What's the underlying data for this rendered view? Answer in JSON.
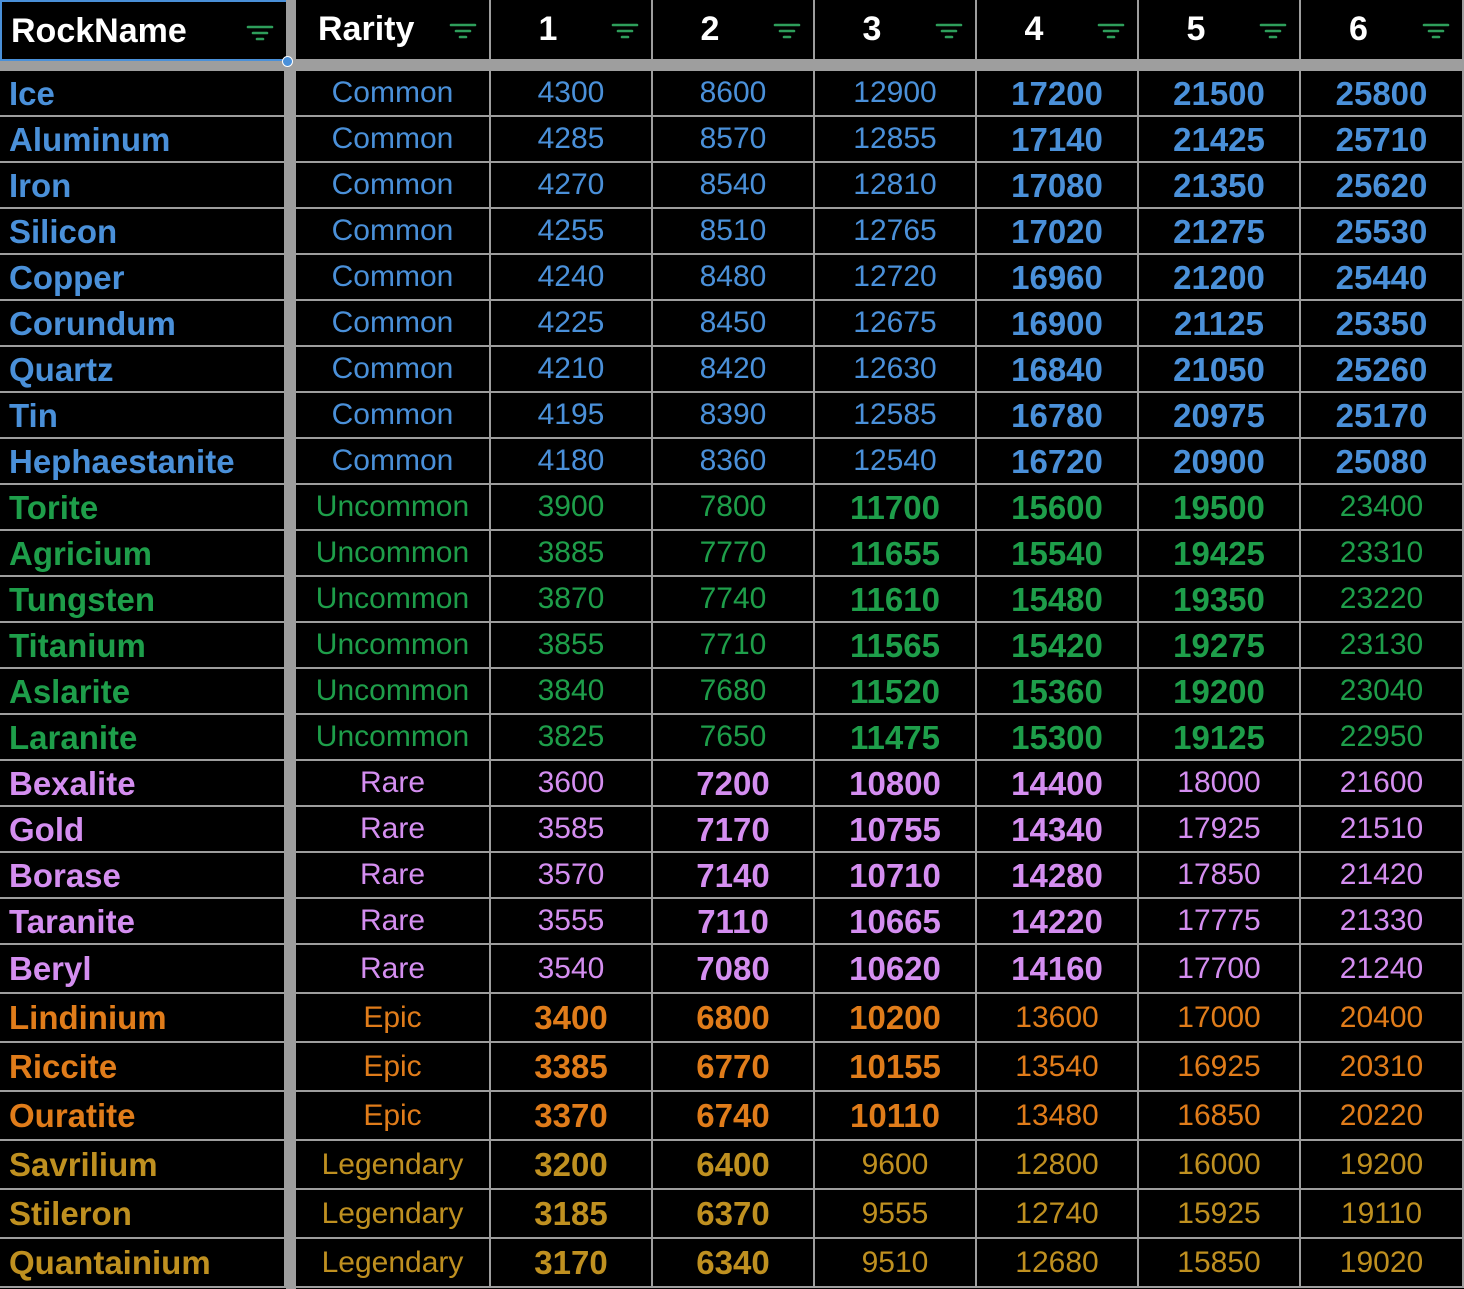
{
  "headers": [
    "RockName",
    "Rarity",
    "1",
    "2",
    "3",
    "4",
    "5",
    "6"
  ],
  "rarity_colors": {
    "Common": "#4a90d9",
    "Uncommon": "#1e9e4a",
    "Rare": "#d48ef0",
    "Epic": "#e07c1a",
    "Legendary": "#bf9020"
  },
  "filter_icon_color": "#2e9e5b",
  "rows": [
    {
      "name": "Ice",
      "rarity": "Common",
      "values": [
        "4300",
        "8600",
        "12900",
        "17200",
        "21500",
        "25800"
      ],
      "bold": [
        false,
        false,
        false,
        true,
        true,
        true
      ]
    },
    {
      "name": "Aluminum",
      "rarity": "Common",
      "values": [
        "4285",
        "8570",
        "12855",
        "17140",
        "21425",
        "25710"
      ],
      "bold": [
        false,
        false,
        false,
        true,
        true,
        true
      ]
    },
    {
      "name": "Iron",
      "rarity": "Common",
      "values": [
        "4270",
        "8540",
        "12810",
        "17080",
        "21350",
        "25620"
      ],
      "bold": [
        false,
        false,
        false,
        true,
        true,
        true
      ]
    },
    {
      "name": "Silicon",
      "rarity": "Common",
      "values": [
        "4255",
        "8510",
        "12765",
        "17020",
        "21275",
        "25530"
      ],
      "bold": [
        false,
        false,
        false,
        true,
        true,
        true
      ]
    },
    {
      "name": "Copper",
      "rarity": "Common",
      "values": [
        "4240",
        "8480",
        "12720",
        "16960",
        "21200",
        "25440"
      ],
      "bold": [
        false,
        false,
        false,
        true,
        true,
        true
      ]
    },
    {
      "name": "Corundum",
      "rarity": "Common",
      "values": [
        "4225",
        "8450",
        "12675",
        "16900",
        "21125",
        "25350"
      ],
      "bold": [
        false,
        false,
        false,
        true,
        true,
        true
      ]
    },
    {
      "name": "Quartz",
      "rarity": "Common",
      "values": [
        "4210",
        "8420",
        "12630",
        "16840",
        "21050",
        "25260"
      ],
      "bold": [
        false,
        false,
        false,
        true,
        true,
        true
      ]
    },
    {
      "name": "Tin",
      "rarity": "Common",
      "values": [
        "4195",
        "8390",
        "12585",
        "16780",
        "20975",
        "25170"
      ],
      "bold": [
        false,
        false,
        false,
        true,
        true,
        true
      ]
    },
    {
      "name": "Hephaestanite",
      "rarity": "Common",
      "values": [
        "4180",
        "8360",
        "12540",
        "16720",
        "20900",
        "25080"
      ],
      "bold": [
        false,
        false,
        false,
        true,
        true,
        true
      ]
    },
    {
      "name": "Torite",
      "rarity": "Uncommon",
      "values": [
        "3900",
        "7800",
        "11700",
        "15600",
        "19500",
        "23400"
      ],
      "bold": [
        false,
        false,
        true,
        true,
        true,
        false
      ]
    },
    {
      "name": "Agricium",
      "rarity": "Uncommon",
      "values": [
        "3885",
        "7770",
        "11655",
        "15540",
        "19425",
        "23310"
      ],
      "bold": [
        false,
        false,
        true,
        true,
        true,
        false
      ]
    },
    {
      "name": "Tungsten",
      "rarity": "Uncommon",
      "values": [
        "3870",
        "7740",
        "11610",
        "15480",
        "19350",
        "23220"
      ],
      "bold": [
        false,
        false,
        true,
        true,
        true,
        false
      ]
    },
    {
      "name": "Titanium",
      "rarity": "Uncommon",
      "values": [
        "3855",
        "7710",
        "11565",
        "15420",
        "19275",
        "23130"
      ],
      "bold": [
        false,
        false,
        true,
        true,
        true,
        false
      ]
    },
    {
      "name": "Aslarite",
      "rarity": "Uncommon",
      "values": [
        "3840",
        "7680",
        "11520",
        "15360",
        "19200",
        "23040"
      ],
      "bold": [
        false,
        false,
        true,
        true,
        true,
        false
      ]
    },
    {
      "name": "Laranite",
      "rarity": "Uncommon",
      "values": [
        "3825",
        "7650",
        "11475",
        "15300",
        "19125",
        "22950"
      ],
      "bold": [
        false,
        false,
        true,
        true,
        true,
        false
      ]
    },
    {
      "name": "Bexalite",
      "rarity": "Rare",
      "values": [
        "3600",
        "7200",
        "10800",
        "14400",
        "18000",
        "21600"
      ],
      "bold": [
        false,
        true,
        true,
        true,
        false,
        false
      ]
    },
    {
      "name": "Gold",
      "rarity": "Rare",
      "values": [
        "3585",
        "7170",
        "10755",
        "14340",
        "17925",
        "21510"
      ],
      "bold": [
        false,
        true,
        true,
        true,
        false,
        false
      ]
    },
    {
      "name": "Borase",
      "rarity": "Rare",
      "values": [
        "3570",
        "7140",
        "10710",
        "14280",
        "17850",
        "21420"
      ],
      "bold": [
        false,
        true,
        true,
        true,
        false,
        false
      ]
    },
    {
      "name": "Taranite",
      "rarity": "Rare",
      "values": [
        "3555",
        "7110",
        "10665",
        "14220",
        "17775",
        "21330"
      ],
      "bold": [
        false,
        true,
        true,
        true,
        false,
        false
      ]
    },
    {
      "name": "Beryl",
      "rarity": "Rare",
      "values": [
        "3540",
        "7080",
        "10620",
        "14160",
        "17700",
        "21240"
      ],
      "bold": [
        false,
        true,
        true,
        true,
        false,
        false
      ]
    },
    {
      "name": "Lindinium",
      "rarity": "Epic",
      "values": [
        "3400",
        "6800",
        "10200",
        "13600",
        "17000",
        "20400"
      ],
      "bold": [
        true,
        true,
        true,
        false,
        false,
        false
      ]
    },
    {
      "name": "Riccite",
      "rarity": "Epic",
      "values": [
        "3385",
        "6770",
        "10155",
        "13540",
        "16925",
        "20310"
      ],
      "bold": [
        true,
        true,
        true,
        false,
        false,
        false
      ]
    },
    {
      "name": "Ouratite",
      "rarity": "Epic",
      "values": [
        "3370",
        "6740",
        "10110",
        "13480",
        "16850",
        "20220"
      ],
      "bold": [
        true,
        true,
        true,
        false,
        false,
        false
      ]
    },
    {
      "name": "Savrilium",
      "rarity": "Legendary",
      "values": [
        "3200",
        "6400",
        "9600",
        "12800",
        "16000",
        "19200"
      ],
      "bold": [
        true,
        true,
        false,
        false,
        false,
        false
      ]
    },
    {
      "name": "Stileron",
      "rarity": "Legendary",
      "values": [
        "3185",
        "6370",
        "9555",
        "12740",
        "15925",
        "19110"
      ],
      "bold": [
        true,
        true,
        false,
        false,
        false,
        false
      ]
    },
    {
      "name": "Quantainium",
      "rarity": "Legendary",
      "values": [
        "3170",
        "6340",
        "9510",
        "12680",
        "15850",
        "19020"
      ],
      "bold": [
        true,
        true,
        false,
        false,
        false,
        false
      ]
    }
  ]
}
